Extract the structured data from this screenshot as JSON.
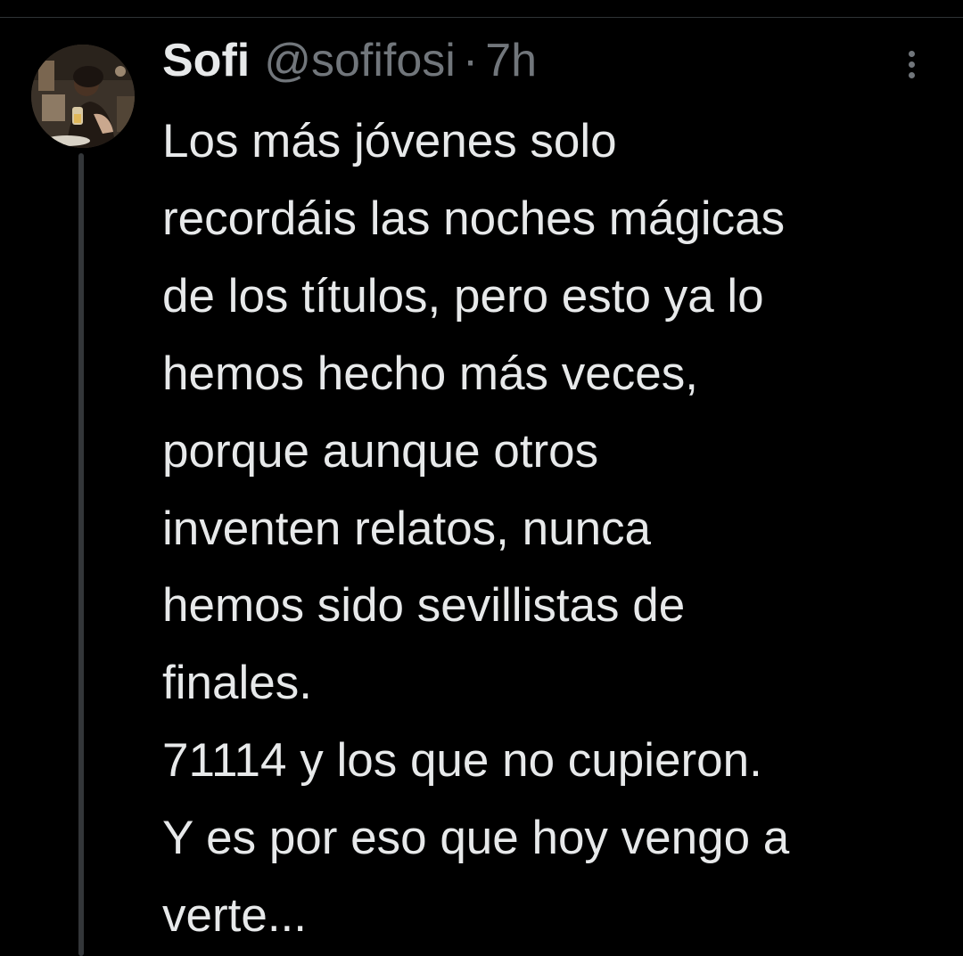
{
  "tweet": {
    "author": {
      "display_name": "Sofi",
      "handle": "@sofifosi",
      "avatar_icon": "user-avatar-photo"
    },
    "separator": "·",
    "timestamp": "7h",
    "more_icon": "more-vertical-icon",
    "text_lines": [
      "Los más jóvenes solo",
      "recordáis las noches mágicas",
      "de los títulos, pero esto ya lo",
      "hemos hecho más veces,",
      "porque aunque otros",
      "inventen relatos, nunca",
      "hemos sido sevillistas de",
      "finales.",
      "71114 y los que no cupieron.",
      "Y es por eso que hoy vengo a",
      "verte..."
    ]
  },
  "colors": {
    "background": "#000000",
    "primary_text": "#e7e9ea",
    "secondary_text": "#71767b",
    "thread_line": "#333639"
  }
}
